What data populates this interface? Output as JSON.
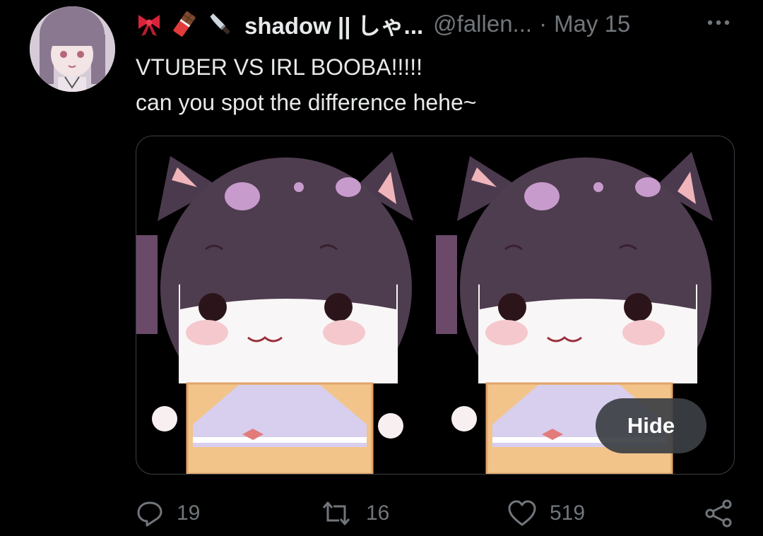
{
  "tweet": {
    "display_name": "shadow || しゃ...",
    "handle": "@fallen...",
    "separator": "·",
    "date": "May 15",
    "emojis": [
      "ribbon-emoji",
      "chocolate-bar-emoji",
      "kitchen-knife-emoji"
    ],
    "text_line1": "VTUBER VS IRL BOOBA!!!!!",
    "text_line2": "can you spot the difference hehe~"
  },
  "media": {
    "hide_label": "Hide",
    "images": [
      "chibi-character-image-left",
      "chibi-character-image-right"
    ]
  },
  "actions": {
    "replies": "19",
    "retweets": "16",
    "likes": "519"
  },
  "colors": {
    "background": "#000000",
    "primary_text": "#e7e9ea",
    "secondary_text": "#71767b",
    "border": "#3b3f44"
  }
}
